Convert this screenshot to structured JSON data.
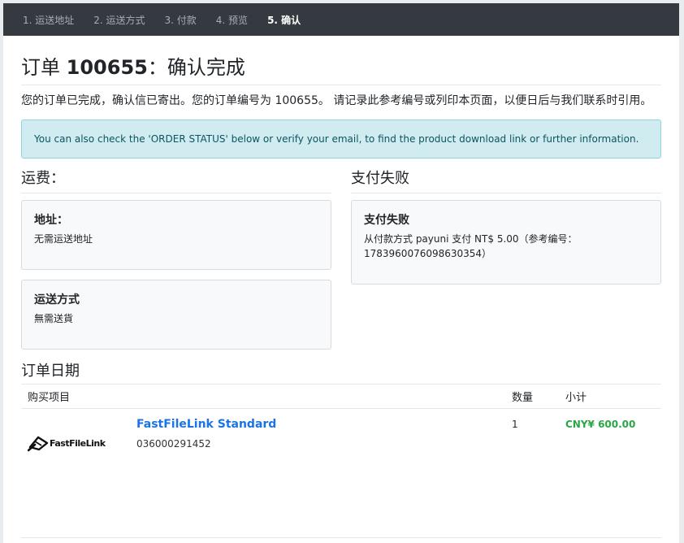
{
  "steps": [
    {
      "label": "1. 运送地址"
    },
    {
      "label": "2. 运送方式"
    },
    {
      "label": "3. 付款"
    },
    {
      "label": "4. 预览"
    },
    {
      "label": "5. 确认"
    }
  ],
  "order": {
    "title_prefix": "订单 ",
    "number": "100655",
    "title_suffix": "：确认完成",
    "message": "您的订单已完成，确认信已寄出。您的订单编号为 100655。 请记录此参考编号或列印本页面，以便日后与我们联系时引用。"
  },
  "alert": {
    "text": "You can also check the 'ORDER STATUS' below or verify your email, to find the product download link or further information."
  },
  "shipping": {
    "heading": "运费：",
    "address_title": "地址：",
    "address_text": "无需运送地址",
    "method_title": "运送方式",
    "method_text": "無需送貨"
  },
  "payment": {
    "heading": "支付失败",
    "card_title": "支付失败",
    "card_text": "从付款方式 payuni 支付 NT$ 5.00（参考编号：1783960076098630354）"
  },
  "items_section": {
    "heading": "订单日期",
    "columns": {
      "item": "购买项目",
      "qty": "数量",
      "subtotal": "小计"
    },
    "rows": [
      {
        "logo_text": "FastFileLink",
        "name": "FastFileLink Standard",
        "sku": "036000291452",
        "qty": "1",
        "subtotal": "CNY¥ 600.00"
      }
    ]
  },
  "colors": {
    "nav_bg": "#343a40",
    "link": "#1a73e8",
    "price": "#28a745",
    "alert_bg": "#d1ecf1"
  }
}
